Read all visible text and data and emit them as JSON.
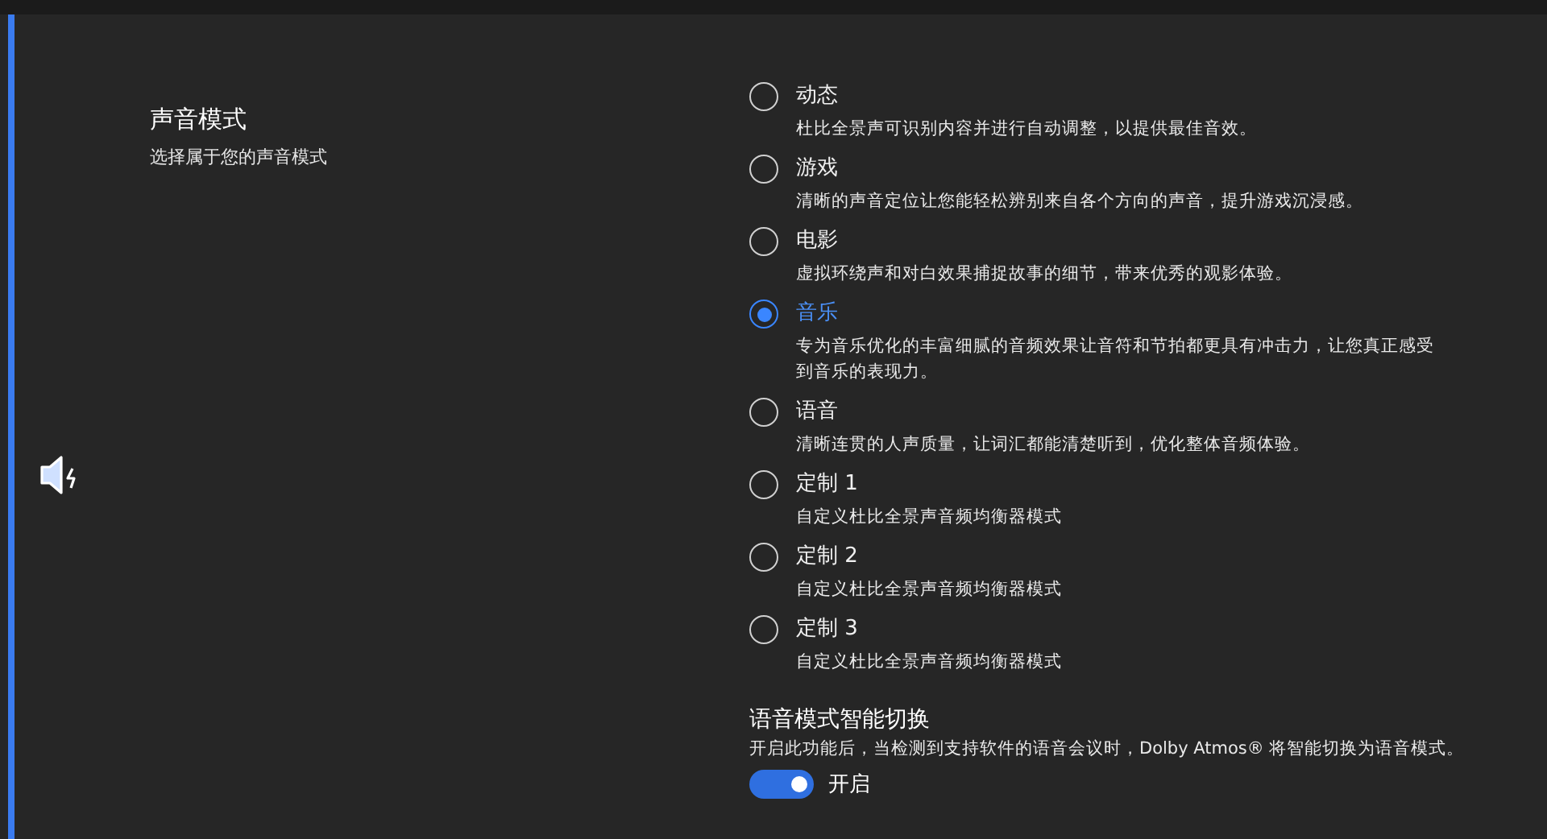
{
  "section": {
    "title": "声音模式",
    "subtitle": "选择属于您的声音模式"
  },
  "modes": [
    {
      "label": "动态",
      "description": "杜比全景声可识别内容并进行自动调整，以提供最佳音效。",
      "selected": false
    },
    {
      "label": "游戏",
      "description": "清晰的声音定位让您能轻松辨别来自各个方向的声音，提升游戏沉浸感。",
      "selected": false
    },
    {
      "label": "电影",
      "description": "虚拟环绕声和对白效果捕捉故事的细节，带来优秀的观影体验。",
      "selected": false
    },
    {
      "label": "音乐",
      "description": "专为音乐优化的丰富细腻的音频效果让音符和节拍都更具有冲击力，让您真正感受到音乐的表现力。",
      "selected": true
    },
    {
      "label": "语音",
      "description": "清晰连贯的人声质量，让词汇都能清楚听到，优化整体音频体验。",
      "selected": false
    },
    {
      "label": "定制 1",
      "description": "自定义杜比全景声音频均衡器模式",
      "selected": false
    },
    {
      "label": "定制 2",
      "description": "自定义杜比全景声音频均衡器模式",
      "selected": false
    },
    {
      "label": "定制 3",
      "description": "自定义杜比全景声音频均衡器模式",
      "selected": false
    }
  ],
  "smart_switch": {
    "title": "语音模式智能切换",
    "description": "开启此功能后，当检测到支持软件的语音会议时，Dolby Atmos® 将智能切换为语音模式。",
    "on": true,
    "state_label": "开启"
  }
}
